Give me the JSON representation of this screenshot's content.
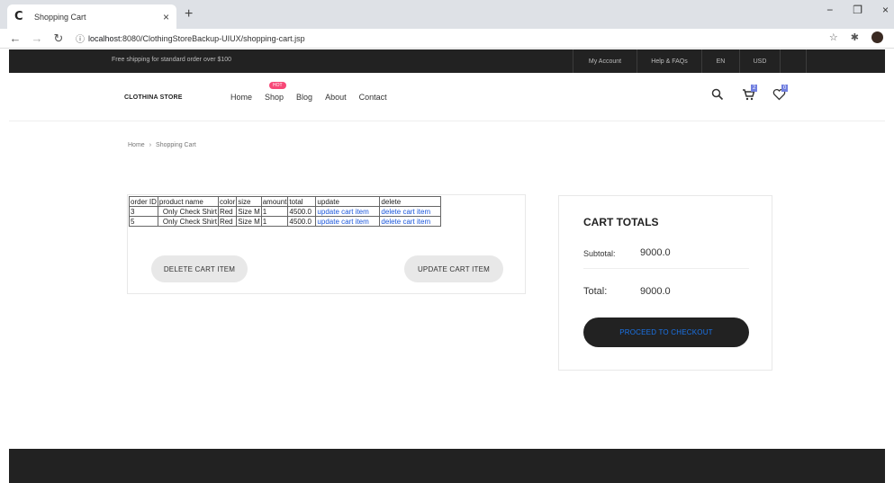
{
  "browser": {
    "tab_favicon": "C",
    "tab_title": "Shopping Cart",
    "tab_close": "×",
    "new_tab": "+",
    "url_host": "localhost",
    "url_rest": ":8080/ClothingStoreBackup-UIUX/shopping-cart.jsp",
    "win_min": "−",
    "win_max": "❐",
    "win_close": "×"
  },
  "topbar": {
    "shipping_text": "Free shipping for standard order over $100",
    "links": [
      "My Account",
      "Help & FAQs",
      "EN",
      "USD"
    ]
  },
  "header": {
    "logo_bold": "CLOTHINA",
    "logo_light": "STORE",
    "menu": [
      "Home",
      "Shop",
      "Blog",
      "About",
      "Contact"
    ],
    "hot_badge": "HOT",
    "cart_count": "2",
    "wishlist_count": "0"
  },
  "breadcrumb": {
    "home": "Home",
    "separator": "›",
    "current": "Shopping Cart"
  },
  "cart_table": {
    "headers": [
      "order ID",
      "product name",
      "color",
      "size",
      "amount",
      "total",
      "update",
      "delete"
    ],
    "rows": [
      [
        "3",
        "Only Check Shirt",
        "Red",
        "Size M",
        "1",
        "4500.0",
        "update cart item",
        "delete cart item"
      ],
      [
        "5",
        "Only Check Shirt",
        "Red",
        "Size M",
        "1",
        "4500.0",
        "update cart item",
        "delete cart item"
      ]
    ]
  },
  "cart_buttons": {
    "delete": "DELETE CART ITEM",
    "update": "UPDATE CART ITEM"
  },
  "totals": {
    "title": "CART TOTALS",
    "subtotal_label": "Subtotal:",
    "subtotal_value": "9000.0",
    "total_label": "Total:",
    "total_value": "9000.0",
    "checkout": "PROCEED TO CHECKOUT"
  },
  "colors": {
    "dark": "#222222",
    "accent_badge": "#717fe0",
    "hot_badge": "#f74877",
    "link_blue": "#1a56db"
  }
}
